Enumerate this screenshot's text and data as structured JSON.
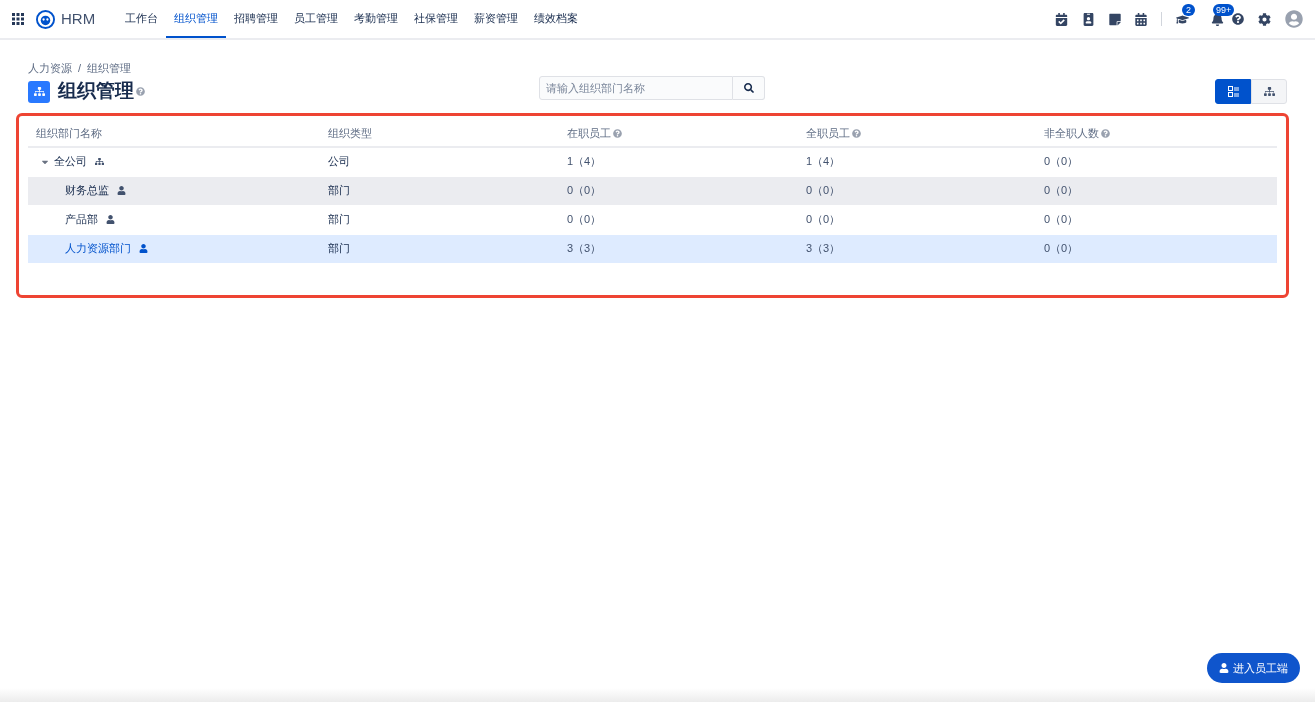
{
  "nav": {
    "brand": "HRM",
    "tabs": [
      {
        "label": "工作台",
        "selected": false
      },
      {
        "label": "组织管理",
        "selected": true
      },
      {
        "label": "招聘管理",
        "selected": false
      },
      {
        "label": "员工管理",
        "selected": false
      },
      {
        "label": "考勤管理",
        "selected": false
      },
      {
        "label": "社保管理",
        "selected": false
      },
      {
        "label": "薪资管理",
        "selected": false
      },
      {
        "label": "绩效档案",
        "selected": false
      }
    ],
    "badges": {
      "graduation": "2",
      "bell": "99+"
    }
  },
  "breadcrumb": {
    "items": [
      "人力资源",
      "组织管理"
    ],
    "separator": "/"
  },
  "title": "组织管理",
  "search": {
    "placeholder": "请输入组织部门名称"
  },
  "view_toggle": [
    {
      "kind": "list",
      "selected": true
    },
    {
      "kind": "tree",
      "selected": false
    }
  ],
  "table": {
    "columns": [
      {
        "label": "组织部门名称",
        "help": false
      },
      {
        "label": "组织类型",
        "help": false
      },
      {
        "label": "在职员工",
        "help": true
      },
      {
        "label": "全职员工",
        "help": true
      },
      {
        "label": "非全职人数",
        "help": true
      }
    ],
    "rows": [
      {
        "name": "全公司",
        "kind": "company",
        "type": "公司",
        "active": "1（4）",
        "fulltime": "1（4）",
        "parttime": "0（0）",
        "expanded": true,
        "selected": false,
        "hovered": false,
        "children": [
          {
            "name": "财务总监",
            "kind": "department",
            "type": "部门",
            "active": "0（0）",
            "fulltime": "0（0）",
            "parttime": "0（0）",
            "selected": false,
            "hovered": true
          },
          {
            "name": "产品部",
            "kind": "department",
            "type": "部门",
            "active": "0（0）",
            "fulltime": "0（0）",
            "parttime": "0（0）",
            "selected": false,
            "hovered": false
          },
          {
            "name": "人力资源部门",
            "kind": "department",
            "type": "部门",
            "active": "3（3）",
            "fulltime": "3（3）",
            "parttime": "0（0）",
            "selected": true
          }
        ]
      }
    ]
  },
  "employee_button": "进入员工端"
}
